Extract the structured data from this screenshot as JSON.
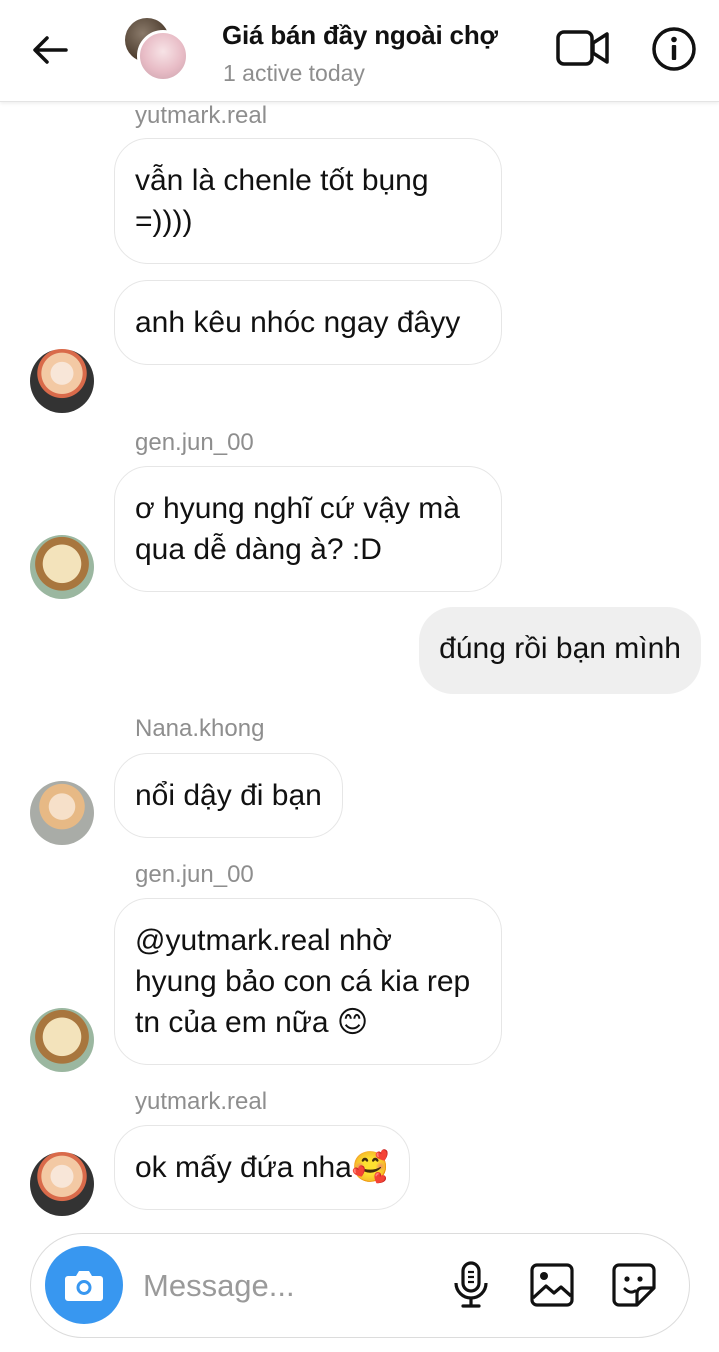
{
  "header": {
    "title": "Giá bán đầy ngoài chợ",
    "status": "1 active today"
  },
  "messages": [
    {
      "sender": "yutmark.real",
      "text": "vẫn là chenle tốt bụng =))))"
    },
    {
      "sender": "yutmark.real",
      "text": "anh kêu nhóc ngay đâyy"
    },
    {
      "sender": "gen.jun_00",
      "text": "ơ hyung nghĩ cứ vậy mà qua dễ dàng à? :D"
    },
    {
      "sender": "me",
      "text": "đúng rồi bạn mình"
    },
    {
      "sender": "Nana.khong",
      "text": "nổi dậy đi bạn"
    },
    {
      "sender": "gen.jun_00",
      "text": "@yutmark.real nhờ hyung bảo con cá kia rep tn của em nữa 😊"
    },
    {
      "sender": "yutmark.real",
      "text": "ok mấy đứa nha🥰"
    }
  ],
  "composer": {
    "placeholder": "Message..."
  },
  "icons": {
    "back": "arrow-left-icon",
    "video": "video-camera-icon",
    "info": "info-icon",
    "camera": "camera-icon",
    "mic": "microphone-icon",
    "gallery": "image-icon",
    "sticker": "sticker-icon"
  },
  "colors": {
    "accent": "#3897f0",
    "own_bubble": "#efefef",
    "secondary_text": "#8e8e8e"
  }
}
